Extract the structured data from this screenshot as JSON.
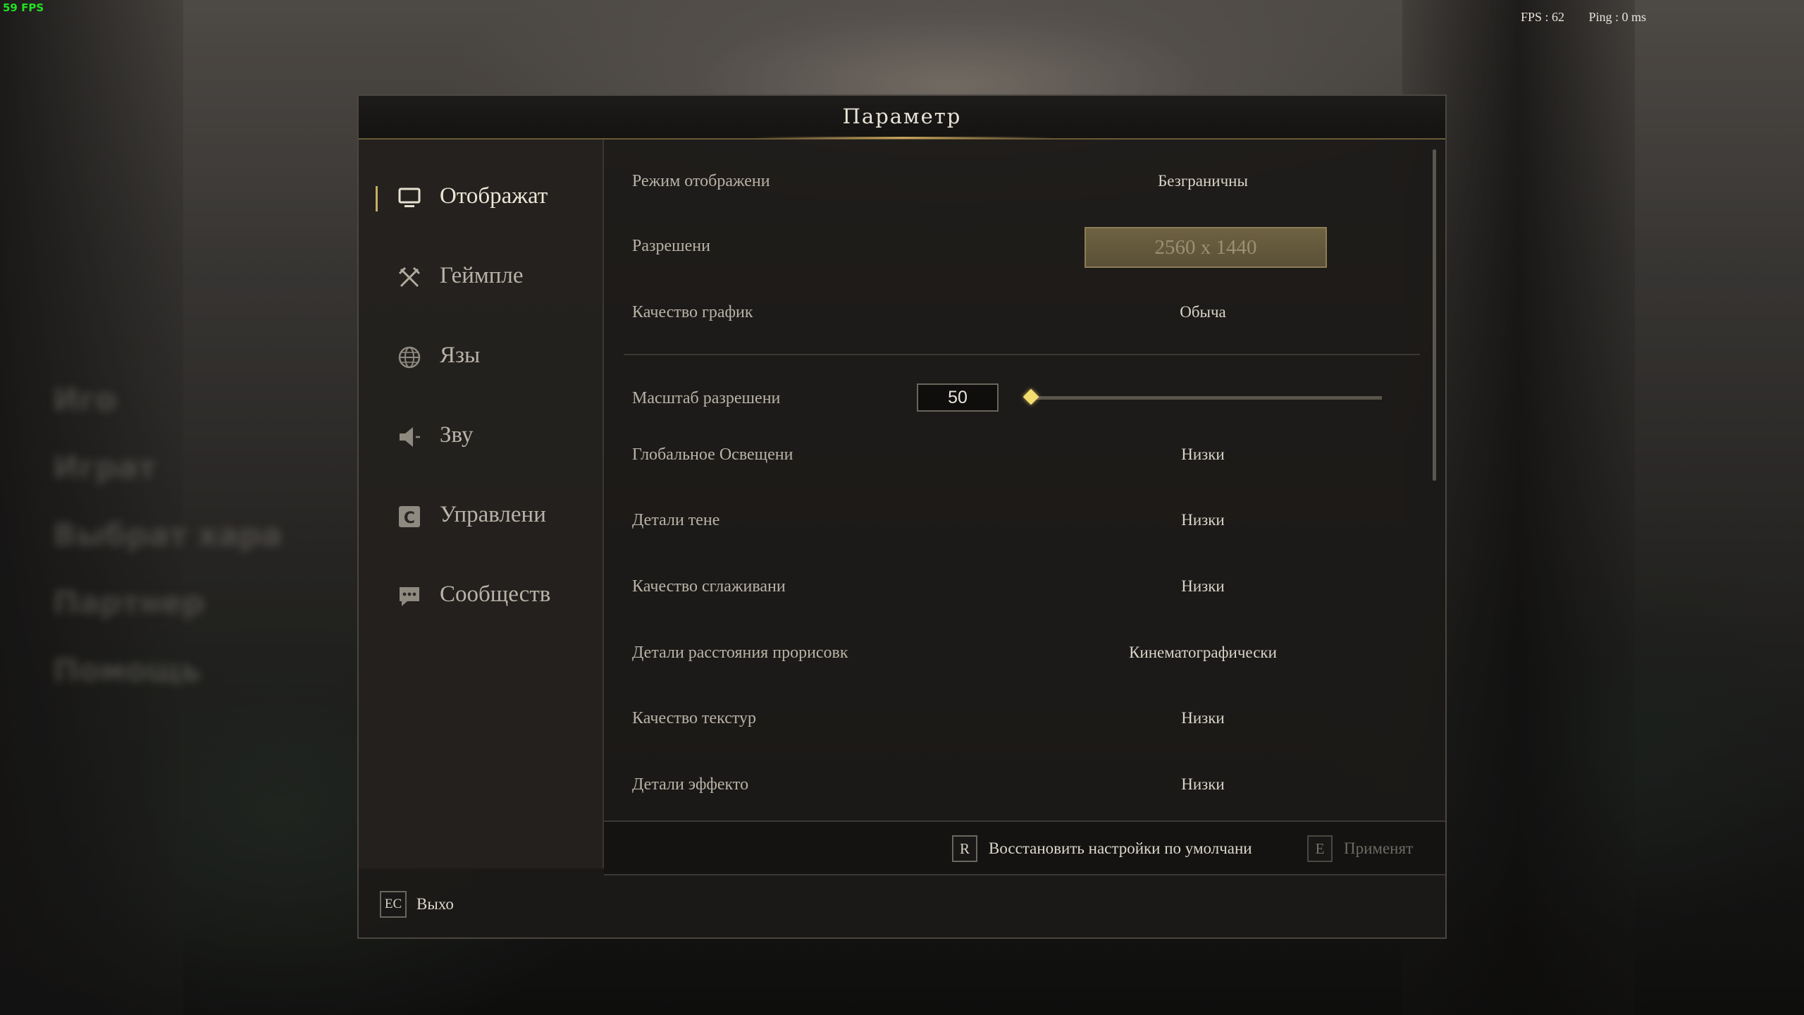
{
  "hud": {
    "fps_overlay": "59 FPS",
    "fps": "FPS : 62",
    "ping": "Ping : 0 ms"
  },
  "background_menu": [
    "Иго",
    "Играт",
    "Выбрат хара",
    "Партнер",
    "Помощь"
  ],
  "dialog": {
    "title": "Параметр"
  },
  "sidebar": {
    "items": [
      {
        "label": "Отображат",
        "icon": "monitor-icon",
        "active": true
      },
      {
        "label": "Геймпле",
        "icon": "crossed-swords-icon",
        "active": false
      },
      {
        "label": "Язы",
        "icon": "globe-icon",
        "active": false
      },
      {
        "label": "Зву",
        "icon": "speaker-icon",
        "active": false
      },
      {
        "label": "Управлени",
        "icon": "controls-icon",
        "active": false
      },
      {
        "label": "Сообществ",
        "icon": "chat-bubble-icon",
        "active": false
      }
    ]
  },
  "settings": {
    "display_mode": {
      "label": "Режим отображени",
      "value": "Безграничны"
    },
    "resolution": {
      "label": "Разрешени",
      "value": "2560 x 1440"
    },
    "graphics_quality": {
      "label": "Качество график",
      "value": "Обыча"
    },
    "resolution_scale": {
      "label": "Масштаб разрешени",
      "value": "50",
      "slider_fraction": 0.0
    },
    "global_illumination": {
      "label": "Глобальное Освещени",
      "value": "Низки"
    },
    "shadow_detail": {
      "label": "Детали тене",
      "value": "Низки"
    },
    "anti_aliasing": {
      "label": "Качество сглаживани",
      "value": "Низки"
    },
    "view_distance": {
      "label": "Детали расстояния прорисовк",
      "value": "Кинематографически"
    },
    "texture_quality": {
      "label": "Качество текстур",
      "value": "Низки"
    },
    "effects_detail": {
      "label": "Детали эффекто",
      "value": "Низки"
    }
  },
  "footer": {
    "reset_key": "R",
    "reset_label": "Восстановить настройки по умолчани",
    "apply_key": "E",
    "apply_label": "Применят",
    "exit_key": "EC",
    "exit_label": "Выхо"
  },
  "colors": {
    "accent_gold": "#c9ad64",
    "slider_thumb": "#f4dd6e",
    "fps_green": "#22e022"
  }
}
